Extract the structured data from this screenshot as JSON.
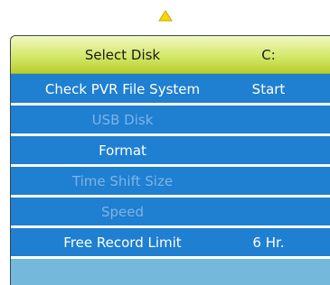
{
  "navigation": {
    "up_icon": "up-triangle-icon",
    "up_icon_color": "#f5d800"
  },
  "menu": {
    "items": [
      {
        "label": "Select Disk",
        "value": "C:",
        "state": "highlighted"
      },
      {
        "label": "Check PVR File System",
        "value": "Start",
        "state": "enabled"
      },
      {
        "label": "USB Disk",
        "value": "",
        "state": "disabled"
      },
      {
        "label": "Format",
        "value": "",
        "state": "enabled"
      },
      {
        "label": "Time Shift Size",
        "value": "",
        "state": "disabled"
      },
      {
        "label": "Speed",
        "value": "",
        "state": "disabled"
      },
      {
        "label": "Free Record Limit",
        "value": "6 Hr.",
        "state": "enabled"
      }
    ]
  },
  "colors": {
    "menu_background": "#1f7fd0",
    "highlight": "#d4e86a",
    "disabled_text": "#7fb4e6",
    "footer": "#74b9db"
  }
}
